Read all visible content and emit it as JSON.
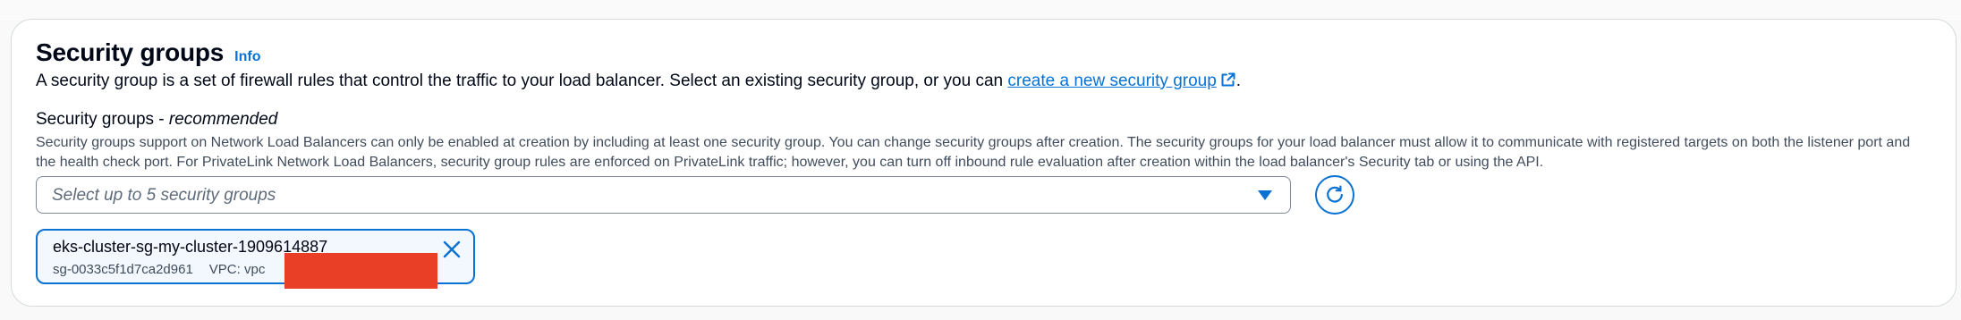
{
  "section": {
    "title": "Security groups",
    "info_label": "Info",
    "description_prefix": "A security group is a set of firewall rules that control the traffic to your load balancer. Select an existing security group, or you can ",
    "description_link": "create a new security group",
    "description_suffix": "."
  },
  "field": {
    "label_prefix": "Security groups - ",
    "label_emphasis": "recommended",
    "description": "Security groups support on Network Load Balancers can only be enabled at creation by including at least one security group. You can change security groups after creation. The security groups for your load balancer must allow it to communicate with registered targets on both the listener port and the health check port. For PrivateLink Network Load Balancers, security group rules are enforced on PrivateLink traffic; however, you can turn off inbound rule evaluation after creation within the load balancer's Security tab or using the API.",
    "placeholder": "Select up to 5 security groups"
  },
  "selected_groups": [
    {
      "name": "eks-cluster-sg-my-cluster-1909614887",
      "id": "sg-0033c5f1d7ca2d961",
      "vpc_label": "VPC: vpc"
    }
  ],
  "icons": {
    "external": "external-link-icon",
    "caret": "caret-down-icon",
    "refresh": "refresh-icon",
    "close": "close-icon"
  },
  "colors": {
    "link": "#0972d3",
    "text": "#000716",
    "secondary_text": "#414d5c",
    "placeholder": "#5f6b7a",
    "token_bg": "#f2f8fd",
    "redaction": "#e83f26"
  }
}
